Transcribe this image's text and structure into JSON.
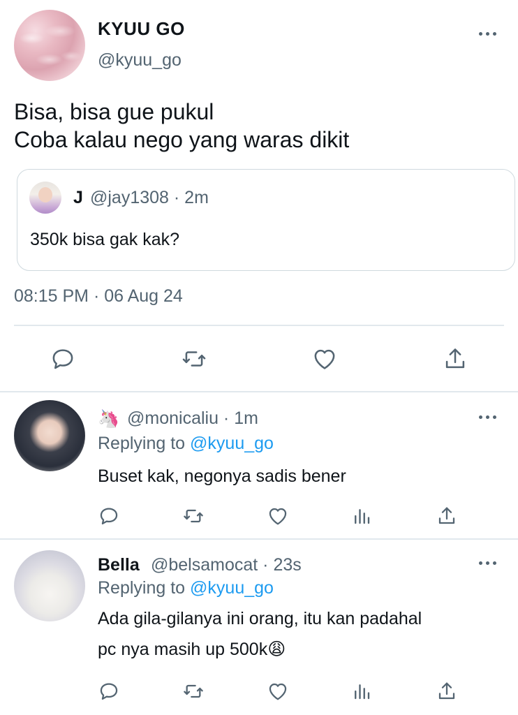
{
  "main_tweet": {
    "display_name": "KYUU GO",
    "handle": "@kyuu_go",
    "text": "Bisa, bisa gue pukul\nCoba kalau nego yang waras dikit",
    "quote": {
      "name": "J",
      "meta": "@jay1308 · 2m",
      "text": "350k bisa gak kak?"
    },
    "timestamp": "08:15 PM · 06 Aug 24"
  },
  "replies": [
    {
      "name_emoji": "🦄",
      "meta": "@monicaliu · 1m",
      "replying_prefix": "Replying to ",
      "replying_mention": "@kyuu_go",
      "text": "Buset kak, negonya sadis bener"
    },
    {
      "name": "Bella",
      "meta": "@belsamocat · 23s",
      "replying_prefix": "Replying to ",
      "replying_mention": "@kyuu_go",
      "text": "Ada gila-gilanya ini orang, itu kan padahal\npc nya masih up 500k",
      "text_emoji": "😩"
    }
  ],
  "icons": [
    "more-icon",
    "reply-icon",
    "retweet-icon",
    "like-icon",
    "share-icon",
    "analytics-icon"
  ],
  "colors": {
    "accent": "#1d9bf0",
    "secondary_text": "#536471",
    "border": "#cfd9de"
  }
}
